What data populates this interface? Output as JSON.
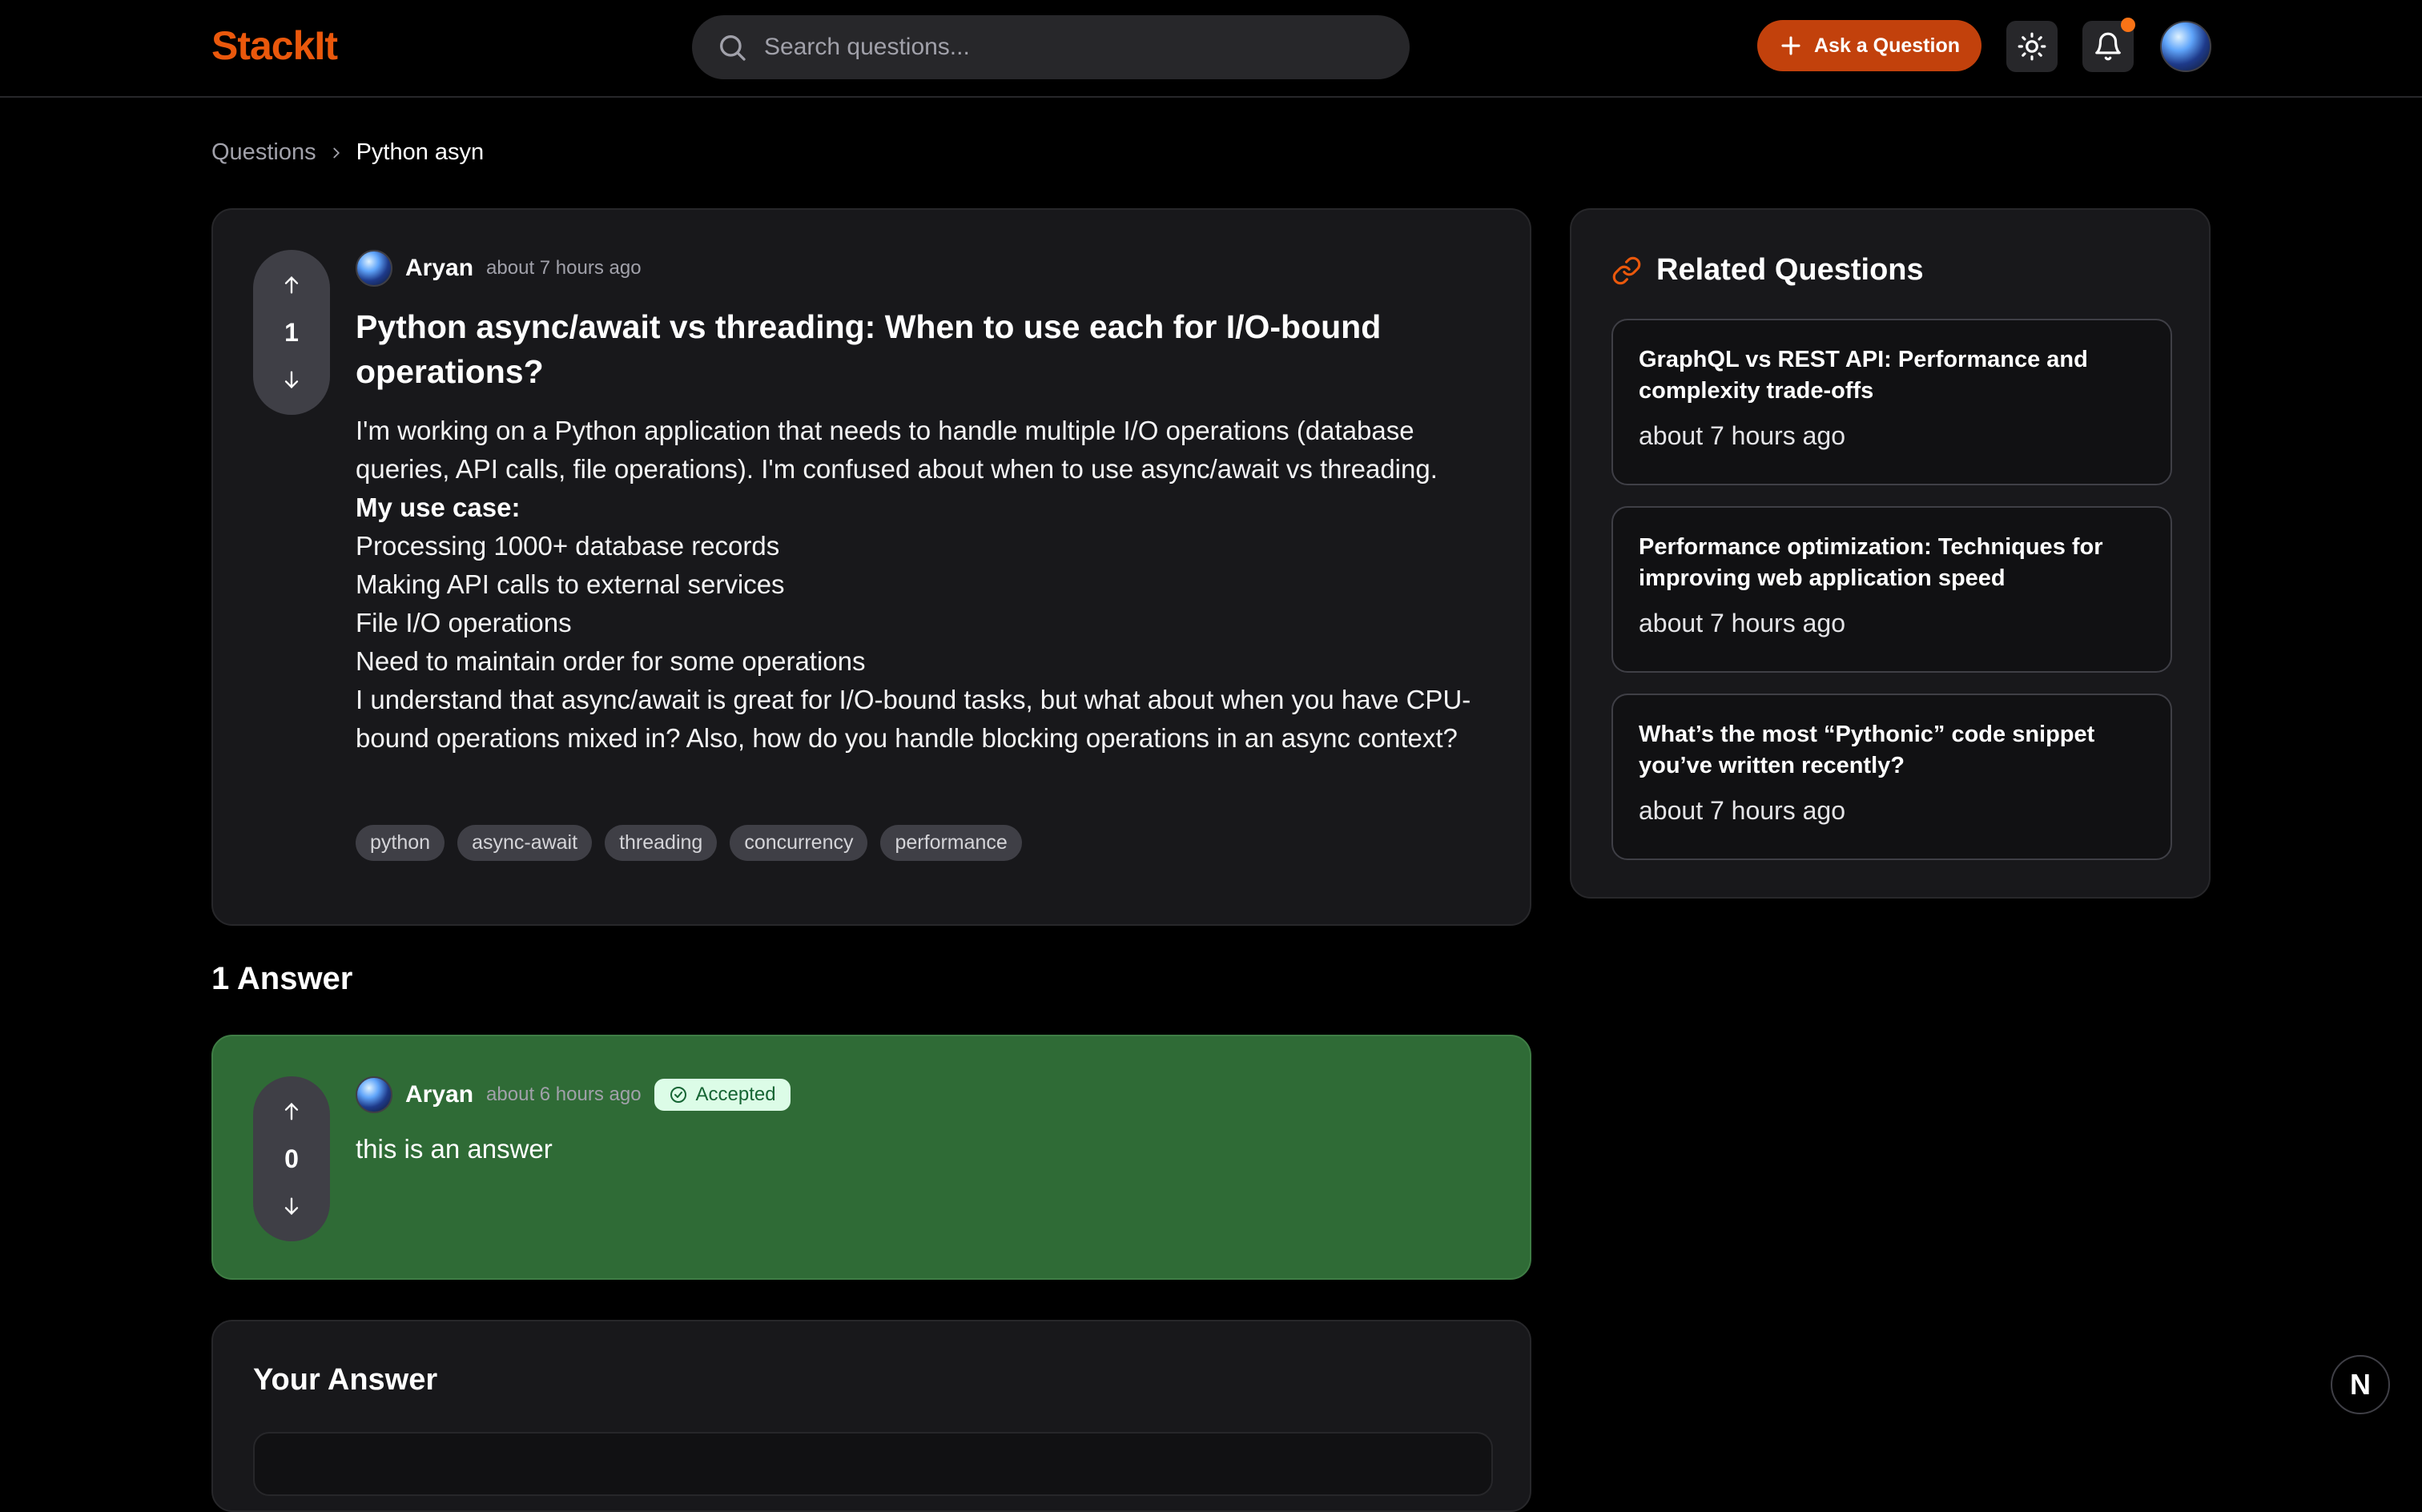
{
  "app": {
    "logo": "StackIt"
  },
  "header": {
    "search_placeholder": "Search questions...",
    "ask_label": "Ask a Question",
    "accent_color": "#ea580c",
    "icons": [
      "search-icon",
      "plus-icon",
      "sun-icon",
      "bell-icon"
    ]
  },
  "breadcrumb": {
    "root": "Questions",
    "current": "Python asyn"
  },
  "question": {
    "votes": "1",
    "author": "Aryan",
    "time": "about 7 hours ago",
    "title": "Python async/await vs threading: When to use each for I/O-bound operations?",
    "intro": "I'm working on a Python application that needs to handle multiple I/O operations (database queries, API calls, file operations). I'm confused about when to use async/await vs threading.",
    "use_case_label": "My use case:",
    "use_cases": [
      "Processing 1000+ database records",
      "Making API calls to external services",
      "File I/O operations",
      "Need to maintain order for some operations"
    ],
    "closing": "I understand that async/await is great for I/O-bound tasks, but what about when you have CPU-bound operations mixed in? Also, how do you handle blocking operations in an async context?",
    "tags": [
      "python",
      "async-await",
      "threading",
      "concurrency",
      "performance"
    ]
  },
  "answers": {
    "heading": "1 Answer",
    "items": [
      {
        "votes": "0",
        "author": "Aryan",
        "time": "about 6 hours ago",
        "badge": "Accepted",
        "body": "this is an answer"
      }
    ]
  },
  "your_answer": {
    "title": "Your Answer"
  },
  "related": {
    "title": "Related Questions",
    "items": [
      {
        "title": "GraphQL vs REST API: Performance and complexity trade-offs",
        "time": "about 7 hours ago"
      },
      {
        "title": "Performance optimization: Techniques for improving web application speed",
        "time": "about 7 hours ago"
      },
      {
        "title": "What’s the most “Pythonic” code snippet you’ve written recently?",
        "time": "about 7 hours ago"
      }
    ]
  },
  "floating": {
    "badge": "N"
  }
}
